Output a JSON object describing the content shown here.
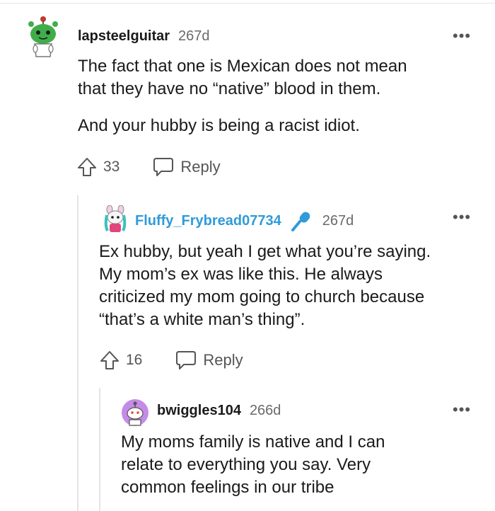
{
  "comments": [
    {
      "username": "lapsteelguitar",
      "age": "267d",
      "paragraphs": [
        [
          "The fact that one is Mexican does not mean",
          "that they have no “native” blood in them."
        ],
        [
          "And your hubby is being a racist idiot."
        ]
      ],
      "votes": "33",
      "reply_label": "Reply"
    },
    {
      "username": "Fluffy_Frybread07734",
      "age": "267d",
      "lines": [
        "Ex hubby, but yeah I get what you’re saying.",
        "My mom’s ex was like this. He always",
        "criticized my mom going to church because",
        "“that’s a white man’s thing”."
      ],
      "votes": "16",
      "reply_label": "Reply"
    },
    {
      "username": "bwiggles104",
      "age": "266d",
      "lines": [
        "My moms family is native and I can",
        "relate to everything you say. Very",
        "common feelings in our tribe"
      ]
    }
  ],
  "more_glyph": "•••",
  "colors": {
    "flair_username": "#2f9bd9",
    "avatar_green": "#3fae4a",
    "avatar_purple": "#c58be8",
    "mic_blue": "#2f9bd9"
  },
  "icons": [
    "snoo-avatar-icon",
    "microphone-icon",
    "upvote-arrow-icon",
    "reply-bubble-icon",
    "more-options-icon"
  ]
}
